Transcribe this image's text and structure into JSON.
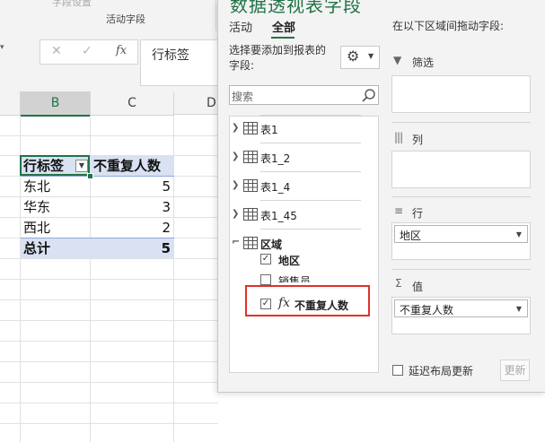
{
  "ribbon": {
    "ghost_label": "字段设置",
    "group_label": "活动字段"
  },
  "formula_bar": {
    "cancel_glyph": "✕",
    "enter_glyph": "✓",
    "fx_label": "fx",
    "value": "行标签"
  },
  "columns": [
    "B",
    "C",
    "D"
  ],
  "pivot_table": {
    "header": {
      "row_label": "行标签",
      "value_label": "不重复人数"
    },
    "rows": [
      {
        "label": "东北",
        "value": "5"
      },
      {
        "label": "华东",
        "value": "3"
      },
      {
        "label": "西北",
        "value": "2"
      }
    ],
    "total": {
      "label": "总计",
      "value": "5"
    }
  },
  "field_pane": {
    "title": "数据透视表字段",
    "tabs": [
      "活动",
      "全部"
    ],
    "active_tab": "全部",
    "instruction": "选择要添加到报表的字段:",
    "gear_icon": "gear-icon",
    "search_placeholder": "搜索",
    "tables": [
      "表1",
      "表1_2",
      "表1_4",
      "表1_45"
    ],
    "expanded_table": {
      "name": "区域",
      "fields": [
        {
          "label": "地区",
          "checked": true
        },
        {
          "label": "销售员",
          "checked": false
        },
        {
          "label": "不重复人数",
          "checked": true,
          "measure": true,
          "measure_icon": "fx"
        }
      ]
    },
    "areas_title": "在以下区域间拖动字段:",
    "areas": {
      "filters": {
        "label": "筛选",
        "icon": "filter-icon"
      },
      "columns": {
        "label": "列",
        "icon": "columns-icon"
      },
      "rows": {
        "label": "行",
        "icon": "rows-icon",
        "item": "地区"
      },
      "values": {
        "label": "值",
        "icon": "sigma-icon",
        "item": "不重复人数"
      }
    },
    "defer_label": "延迟布局更新",
    "update_label": "更新"
  },
  "colors": {
    "accent": "#217346",
    "pivot_header_fill": "#d9e1f2",
    "highlight_border": "#e0312b"
  }
}
